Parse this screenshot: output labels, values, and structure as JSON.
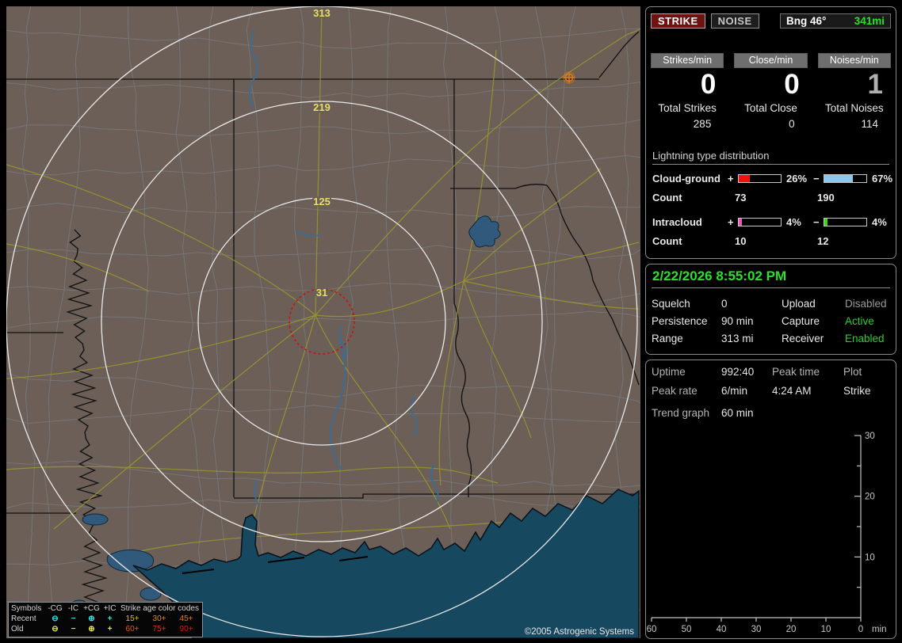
{
  "map": {
    "ring_labels": [
      "313",
      "219",
      "125",
      "31"
    ],
    "ring_label_color": "#e6df63",
    "copyright": "©2005 Astrogenic Systems",
    "legend": {
      "symbols_header": "Symbols",
      "symbol_cols": [
        "-CG",
        "-IC",
        "+CG",
        "+IC"
      ],
      "age_header": "Strike age color codes",
      "rows": [
        {
          "label": "Recent",
          "color": "#3ae0e8",
          "symbols": [
            "⊖",
            "−",
            "⊕",
            "+"
          ],
          "ages": [
            {
              "text": "15+",
              "color": "#e8b820"
            },
            {
              "text": "30+",
              "color": "#e8881a"
            },
            {
              "text": "45+",
              "color": "#e87812"
            }
          ]
        },
        {
          "label": "Old",
          "color": "#e8e840",
          "symbols": [
            "⊖",
            "−",
            "⊕",
            "+"
          ],
          "ages": [
            {
              "text": "60+",
              "color": "#e05c10"
            },
            {
              "text": "75+",
              "color": "#e0300e"
            },
            {
              "text": "90+",
              "color": "#d81408"
            }
          ]
        }
      ]
    }
  },
  "panel": {
    "toggles": {
      "strike": "STRIKE",
      "noise": "NOISE"
    },
    "bearing": {
      "label": "Bng 46°",
      "value": "341mi",
      "value_color": "#2ce02c"
    },
    "rates": [
      {
        "label": "Strikes/min",
        "value": "0",
        "total_label": "Total Strikes",
        "total": "285"
      },
      {
        "label": "Close/min",
        "value": "0",
        "total_label": "Total Close",
        "total": "0"
      },
      {
        "label": "Noises/min",
        "value": "1",
        "total_label": "Total Noises",
        "total": "114"
      }
    ],
    "distribution": {
      "title": "Lightning type distribution",
      "plus_sign": "+",
      "minus_sign": "−",
      "count_label": "Count",
      "rows": [
        {
          "label": "Cloud-ground",
          "plus_pct": "26%",
          "plus_fill": 26,
          "plus_color": "#ee1111",
          "minus_pct": "67%",
          "minus_fill": 67,
          "minus_color": "#8ec6ea",
          "plus_count": "73",
          "minus_count": "190"
        },
        {
          "label": "Intracloud",
          "plus_pct": "4%",
          "plus_fill": 7,
          "plus_color": "#ee55bb",
          "minus_pct": "4%",
          "minus_fill": 7,
          "minus_color": "#44d022",
          "plus_count": "10",
          "minus_count": "12"
        }
      ]
    },
    "status": {
      "datetime": "2/22/2026 8:55:02 PM",
      "datetime_color": "#2ce02c",
      "rows": [
        {
          "l1": "Squelch",
          "v1": "0",
          "l2": "Upload",
          "v2": "Disabled",
          "v2_color": "#9a9a9a"
        },
        {
          "l1": "Persistence",
          "v1": "90 min",
          "l2": "Capture",
          "v2": "Active",
          "v2_color": "#2ccc2c"
        },
        {
          "l1": "Range",
          "v1": "313 mi",
          "l2": "Receiver",
          "v2": "Enabled",
          "v2_color": "#2ccc2c"
        }
      ]
    },
    "stats": {
      "r1": {
        "c1": "Uptime",
        "c2": "992:40",
        "c3": "Peak time",
        "c4": "Plot"
      },
      "r2": {
        "c1": "Peak rate",
        "c2": "6/min",
        "c3": "4:24 AM",
        "c4": "Strike"
      },
      "r3": {
        "c1": "Trend graph",
        "c2": "60 min"
      }
    }
  },
  "chart_data": {
    "type": "line",
    "title": "Trend graph (60 min)",
    "xlabel": "min",
    "x_ticks": [
      60,
      50,
      40,
      30,
      20,
      10,
      0
    ],
    "xlim": [
      60,
      0
    ],
    "y_ticks": [
      10,
      20,
      30
    ],
    "y_minor_ticks": [
      5,
      15,
      25
    ],
    "ylim": [
      0,
      30
    ],
    "grid": false,
    "series": [],
    "note": "trend graph currently empty - no strike rate history plotted"
  }
}
